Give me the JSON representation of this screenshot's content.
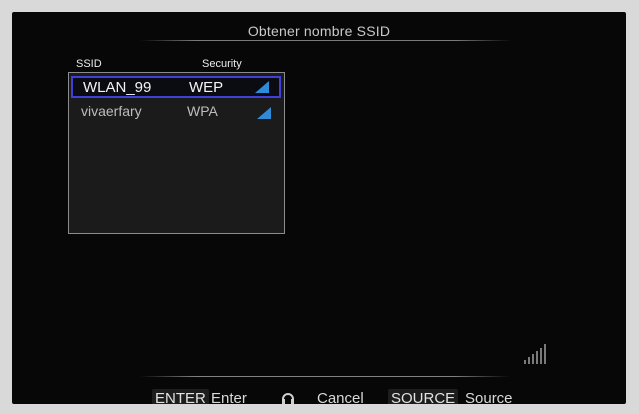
{
  "title": "Obtener nombre SSID",
  "columns": {
    "ssid": "SSID",
    "security": "Security"
  },
  "networks": [
    {
      "ssid": "WLAN_99",
      "security": "WEP",
      "selected": true
    },
    {
      "ssid": "vivaerfary",
      "security": "WPA",
      "selected": false
    }
  ],
  "footer": {
    "enter_key": "ENTER",
    "enter_label": "Enter",
    "cancel_icon": "return-arrow-icon",
    "cancel_label": "Cancel",
    "source_key": "SOURCE",
    "source_label": "Source"
  },
  "colors": {
    "selection_border": "#3f3fd9",
    "signal_blue": "#2f8bd8"
  }
}
